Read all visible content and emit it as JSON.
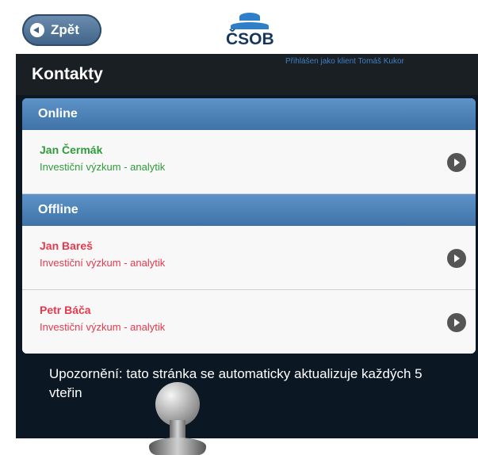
{
  "topbar": {
    "back_label": "Zpět",
    "logo_text": "ČSOB"
  },
  "header": {
    "title": "Kontakty",
    "user_info": "Přihlášen jako klient Tomáš Kukor"
  },
  "groups": [
    {
      "label": "Online",
      "contacts": [
        {
          "name": "Jan Čermák",
          "role": "Investiční výzkum - analytik"
        }
      ]
    },
    {
      "label": "Offline",
      "contacts": [
        {
          "name": "Jan Bareš",
          "role": "Investiční výzkum - analytik"
        },
        {
          "name": "Petr Báča",
          "role": "Investiční výzkum - analytik"
        }
      ]
    }
  ],
  "notice": "Upozornění: tato stránka se automaticky aktualizuje každých 5 vteřin",
  "colors": {
    "online": "#2e9c3a",
    "offline": "#e43a4d",
    "group_header": "#4a80b6",
    "accent": "#3c7fc4"
  }
}
